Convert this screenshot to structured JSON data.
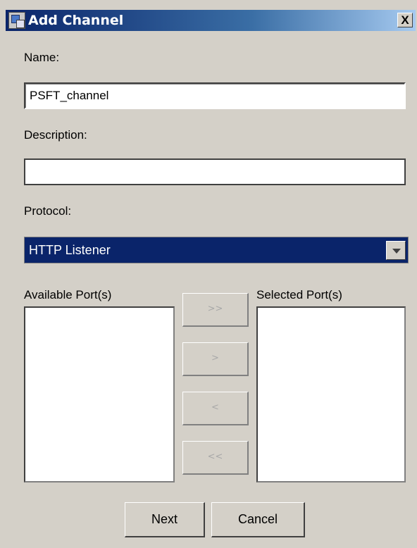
{
  "window": {
    "title": "Add Channel",
    "close_label": "X"
  },
  "form": {
    "name_label": "Name:",
    "name_value": "PSFT_channel",
    "description_label": "Description:",
    "description_value": "",
    "protocol_label": "Protocol:",
    "protocol_value": "HTTP Listener"
  },
  "ports": {
    "available_label": "Available Port(s)",
    "selected_label": "Selected Port(s)",
    "move_all_right_label": ">>",
    "move_right_label": ">",
    "move_left_label": "<",
    "move_all_left_label": "<<"
  },
  "buttons": {
    "next_label": "Next",
    "cancel_label": "Cancel"
  },
  "colors": {
    "titlebar_start": "#0a246a",
    "selection_bg": "#0a246a",
    "dialog_bg": "#d4d0c8"
  },
  "icons": {
    "app_icon": "app-icon",
    "close_icon": "close-icon",
    "dropdown_icon": "chevron-down-icon"
  }
}
